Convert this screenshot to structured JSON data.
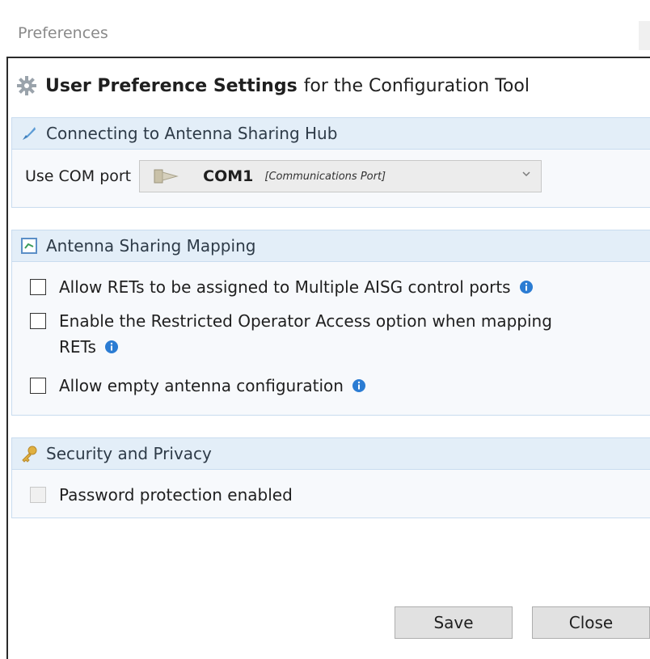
{
  "window": {
    "title": "Preferences"
  },
  "header": {
    "bold": "User Preference Settings",
    "rest": "for the Configuration Tool"
  },
  "groups": {
    "hub": {
      "title": "Connecting to Antenna Sharing Hub",
      "com_label": "Use COM port",
      "com_value": "COM1",
      "com_description": "[Communications Port]"
    },
    "mapping": {
      "title": "Antenna Sharing Mapping",
      "options": [
        {
          "label": "Allow RETs to be assigned to Multiple AISG control ports",
          "checked": false
        },
        {
          "label_line1": "Enable the Restricted Operator Access option when mapping",
          "label_line2": "RETs",
          "checked": false
        },
        {
          "label": "Allow empty antenna configuration",
          "checked": false
        }
      ]
    },
    "security": {
      "title": "Security and Privacy",
      "password_label": "Password protection enabled",
      "password_enabled": false
    }
  },
  "buttons": {
    "save": "Save",
    "close": "Close"
  },
  "icons": {
    "header": "gear-icon",
    "hub": "plug-icon",
    "mapping": "mapping-icon",
    "security": "key-icon",
    "info": "info-icon",
    "port": "com-port-icon"
  },
  "colors": {
    "group_header_bg": "#e3eef8",
    "group_border": "#c9dcef",
    "info_blue": "#2b7cd3"
  }
}
